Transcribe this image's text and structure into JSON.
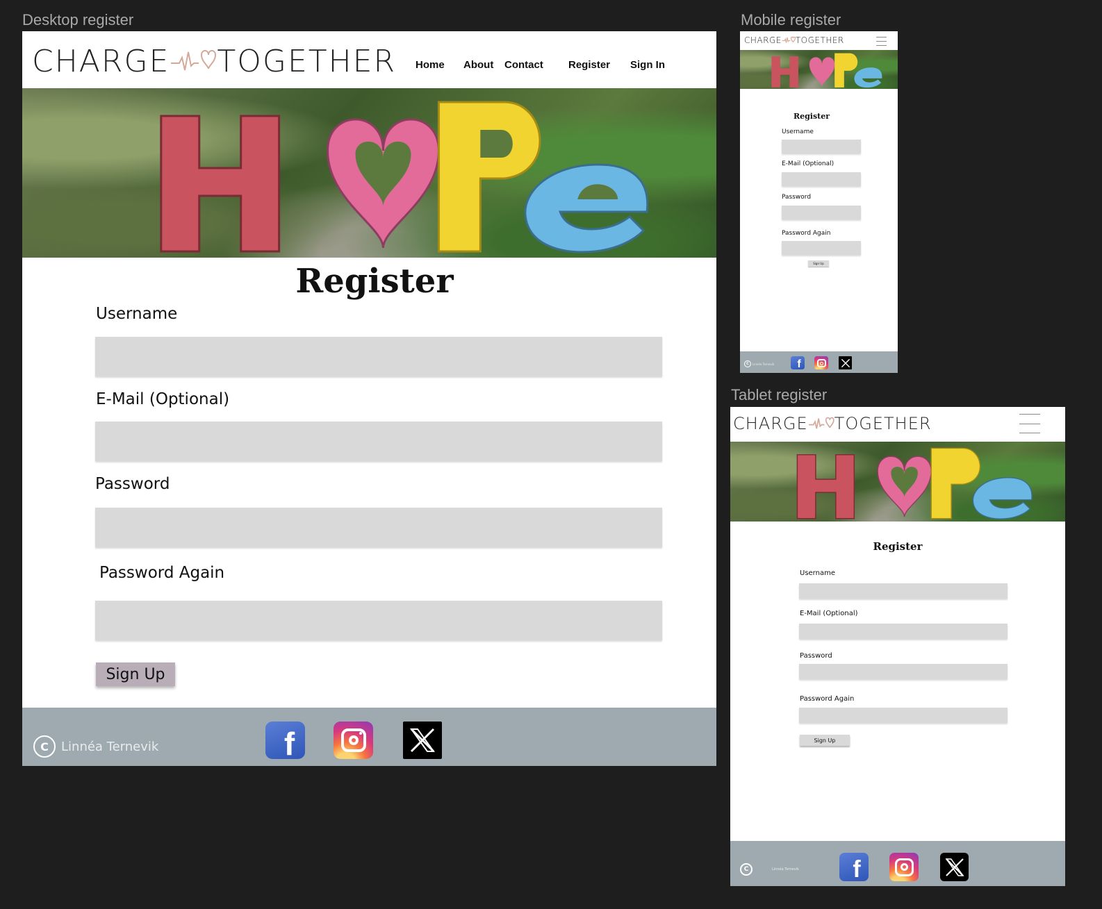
{
  "frames": {
    "desktop_label": "Desktop register",
    "mobile_label": "Mobile register",
    "tablet_label": "Tablet register"
  },
  "logo": {
    "left": "CHARGE",
    "right": "TOGETHER",
    "accent": "#d6a89a"
  },
  "banner": {
    "word": "HOPE"
  },
  "nav": {
    "home": "Home",
    "about": "About",
    "contact": "Contact",
    "register": "Register",
    "signin": "Sign In"
  },
  "form": {
    "title": "Register",
    "username_label": "Username",
    "email_label": "E-Mail (Optional)",
    "password_label": "Password",
    "password_again_label": "Password Again",
    "signup_label": "Sign Up"
  },
  "footer": {
    "copyright_symbol": "C",
    "owner": "Linnéa Ternevik",
    "bg": "#9eaaaf"
  },
  "social": {
    "facebook": "f",
    "instagram": "instagram-icon",
    "x": "x-icon"
  },
  "colors": {
    "page_bg": "#1e1e1e",
    "field_bg": "#d9d9d9",
    "signup_desktop": "#b9aeb8",
    "signup_small": "#d9d9d9"
  }
}
